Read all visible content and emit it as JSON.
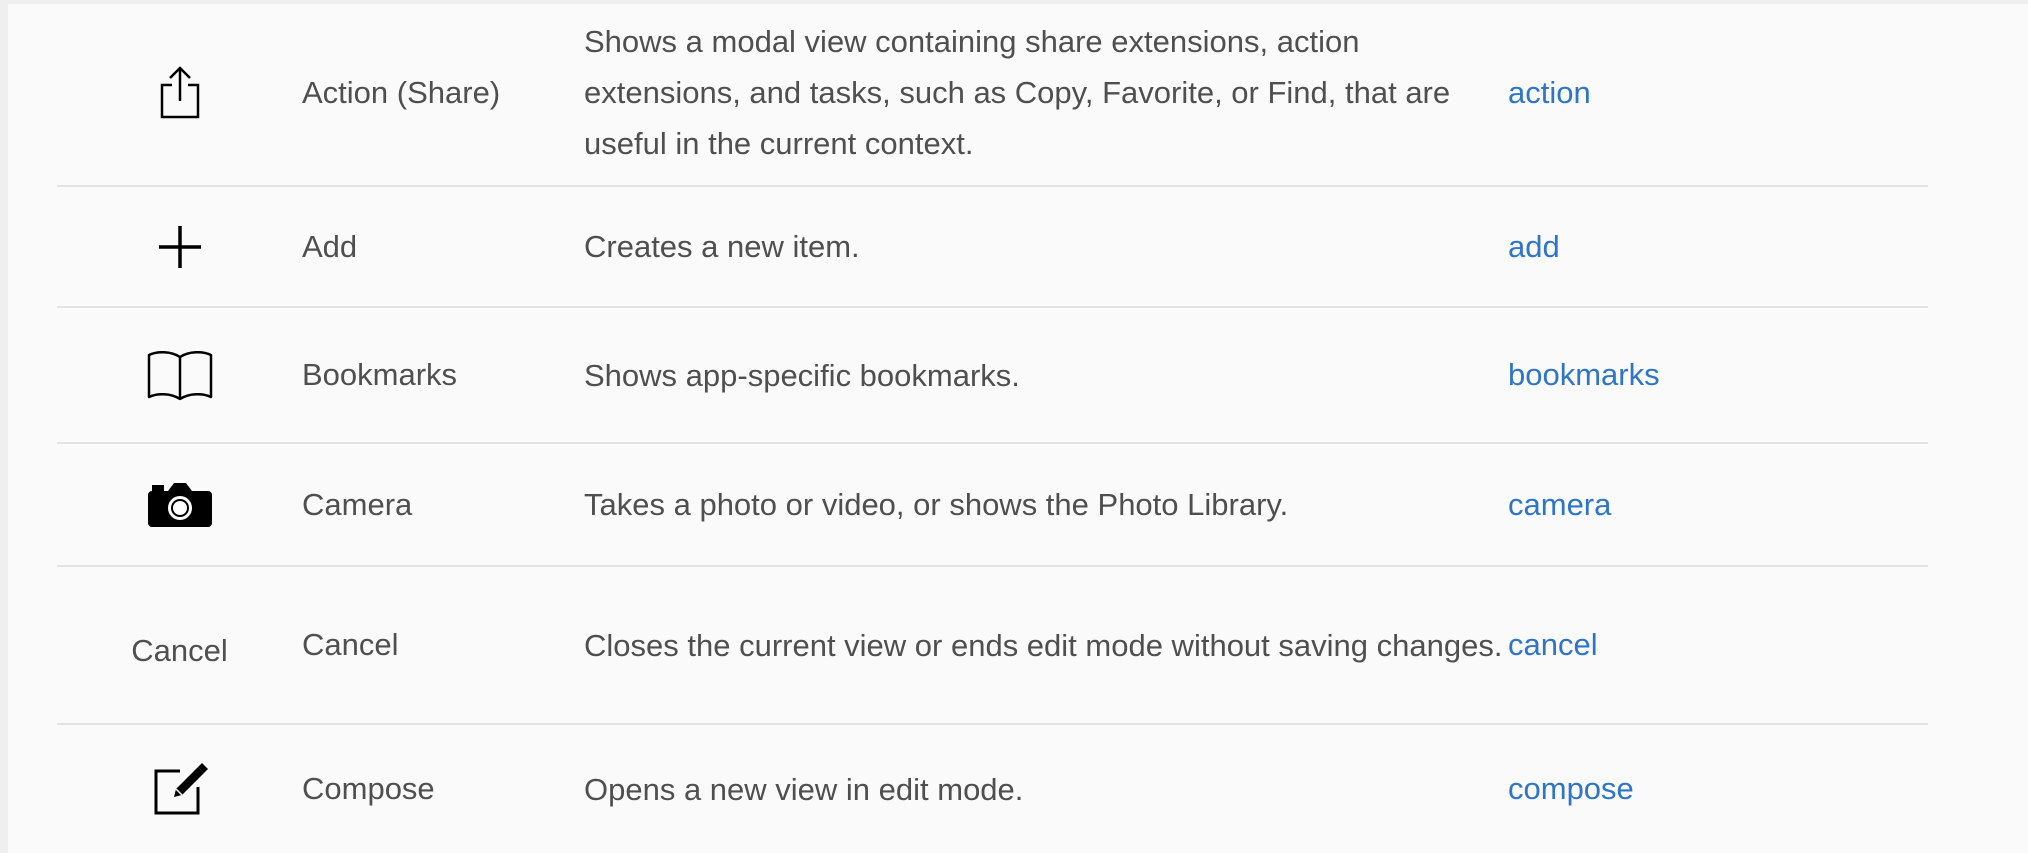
{
  "rows": [
    {
      "icon": "share-icon",
      "name": "Action (Share)",
      "description": "Shows a modal view containing share extensions, action extensions, and tasks, such as Copy, Favorite, or Find, that are useful in the current context.",
      "key": "action"
    },
    {
      "icon": "plus-icon",
      "name": "Add",
      "description": "Creates a new item.",
      "key": "add"
    },
    {
      "icon": "book-icon",
      "name": "Bookmarks",
      "description": "Shows app-specific bookmarks.",
      "key": "bookmarks"
    },
    {
      "icon": "camera-icon",
      "name": "Camera",
      "description": "Takes a photo or video, or shows the Photo Library.",
      "key": "camera"
    },
    {
      "icon_text": "Cancel",
      "name": "Cancel",
      "description": "Closes the current view or ends edit mode without saving changes.",
      "key": "cancel"
    },
    {
      "icon": "compose-icon",
      "name": "Compose",
      "description": "Opens a new view in edit mode.",
      "key": "compose"
    }
  ],
  "colors": {
    "link": "#2f75c7",
    "text": "#4f4f4f",
    "divider": "#e3e3e3",
    "background": "#fafafa"
  }
}
